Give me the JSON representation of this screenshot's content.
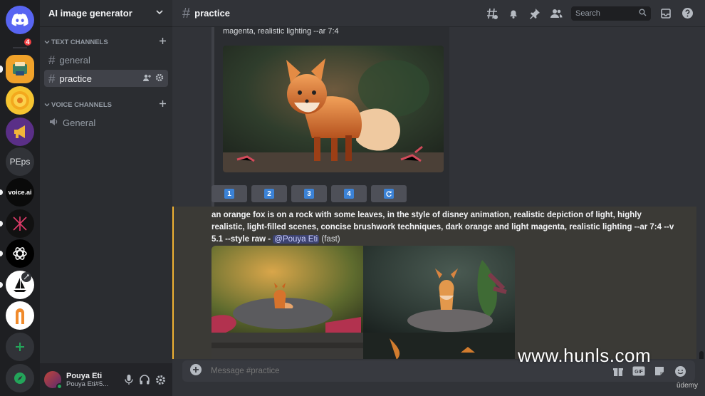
{
  "servers": [
    {
      "name": "discord-home",
      "label": ""
    },
    {
      "name": "server-ai-image",
      "label": ""
    },
    {
      "name": "server-coin",
      "label": ""
    },
    {
      "name": "server-megaphone",
      "label": ""
    },
    {
      "name": "server-peps",
      "label": "PEps"
    },
    {
      "name": "server-voice-ai",
      "label": "voice.ai"
    },
    {
      "name": "server-dark",
      "label": ""
    },
    {
      "name": "server-openai",
      "label": ""
    },
    {
      "name": "server-midjourney",
      "label": ""
    },
    {
      "name": "server-orange",
      "label": ""
    }
  ],
  "home_badge": "4",
  "guild": {
    "name": "AI image generator"
  },
  "categories": {
    "text": "TEXT CHANNELS",
    "voice": "VOICE CHANNELS"
  },
  "channels": {
    "general": "general",
    "practice": "practice",
    "voice_general": "General"
  },
  "user": {
    "name": "Pouya Eti",
    "tag": "Pouya Eti#5..."
  },
  "topbar": {
    "channel": "practice",
    "search_placeholder": "Search"
  },
  "previous_message": {
    "caption": "magenta, realistic lighting --ar 7:4"
  },
  "upscale_buttons": [
    "1",
    "2",
    "3",
    "4"
  ],
  "message": {
    "prompt": "an orange fox is on a rock with some leaves, in the style of disney animation, realistic depiction of light, highly realistic, light-filled scenes, concise brushwork techniques, dark orange and light magenta, realistic lighting --ar 7:4 --v 5.1 --style raw - ",
    "mention": "@Pouya Eti",
    "speed": "(fast)"
  },
  "composer": {
    "placeholder": "Message #practice"
  },
  "watermark": "www.hunls.com",
  "udemy": "ûdemy",
  "colors": {
    "accent": "#f0b232",
    "blurple": "#5865f2",
    "online": "#23a55a",
    "badge": "#f23f42"
  }
}
